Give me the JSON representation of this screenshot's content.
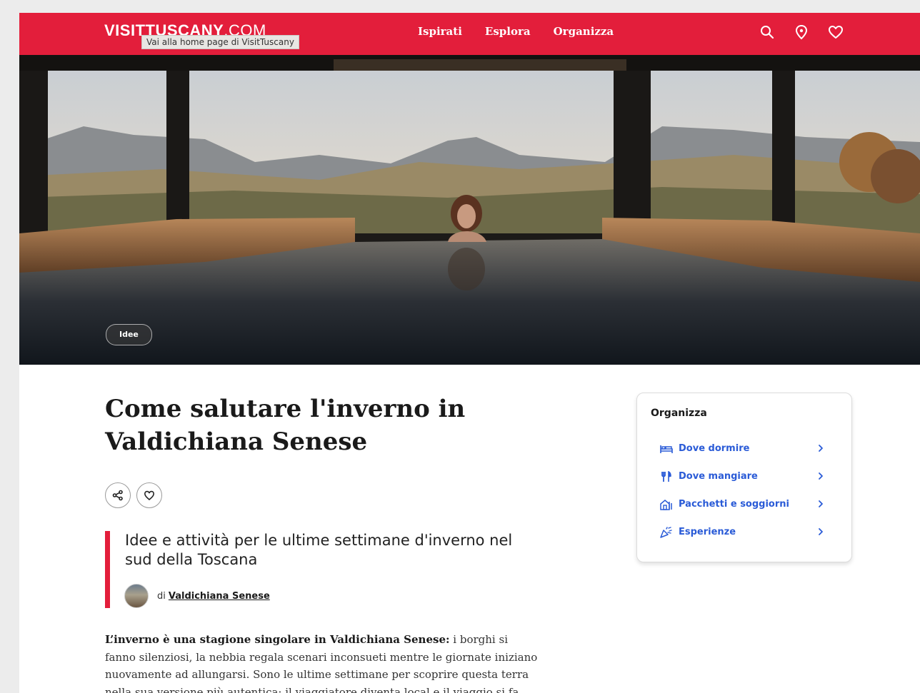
{
  "header": {
    "logo_main": "VISITTUSCANY",
    "logo_suffix": ".COM",
    "tooltip": "Vai alla home page di VisitTuscany",
    "nav": [
      "Ispirati",
      "Esplora",
      "Organizza"
    ]
  },
  "hero": {
    "tag": "Idee"
  },
  "article": {
    "title": "Come salutare l'inverno in Valdichiana Senese",
    "subtitle": "Idee e attività per le ultime settimane d'inverno nel sud della Toscana",
    "author_prefix": "di",
    "author_name": "Valdichiana Senese",
    "body_lead": "L’inverno è una stagione singolare in Valdichiana Senese:",
    "body_rest": " i borghi si fanno silenziosi, la nebbia regala scenari inconsueti mentre le giornate iniziano nuovamente ad allungarsi. Sono le ultime settimane per scoprire questa terra nella sua versione più autentica: il viaggiatore diventa local e il viaggio si fa immersione nella comunità locale."
  },
  "sidebar": {
    "title": "Organizza",
    "items": [
      {
        "label": "Dove dormire",
        "icon": "bed-icon"
      },
      {
        "label": "Dove mangiare",
        "icon": "cutlery-icon"
      },
      {
        "label": "Pacchetti e soggiorni",
        "icon": "house-icon"
      },
      {
        "label": "Esperienze",
        "icon": "party-popper-icon"
      }
    ]
  },
  "colors": {
    "brand_red": "#e31e3b",
    "link_blue": "#2a5bd7"
  }
}
